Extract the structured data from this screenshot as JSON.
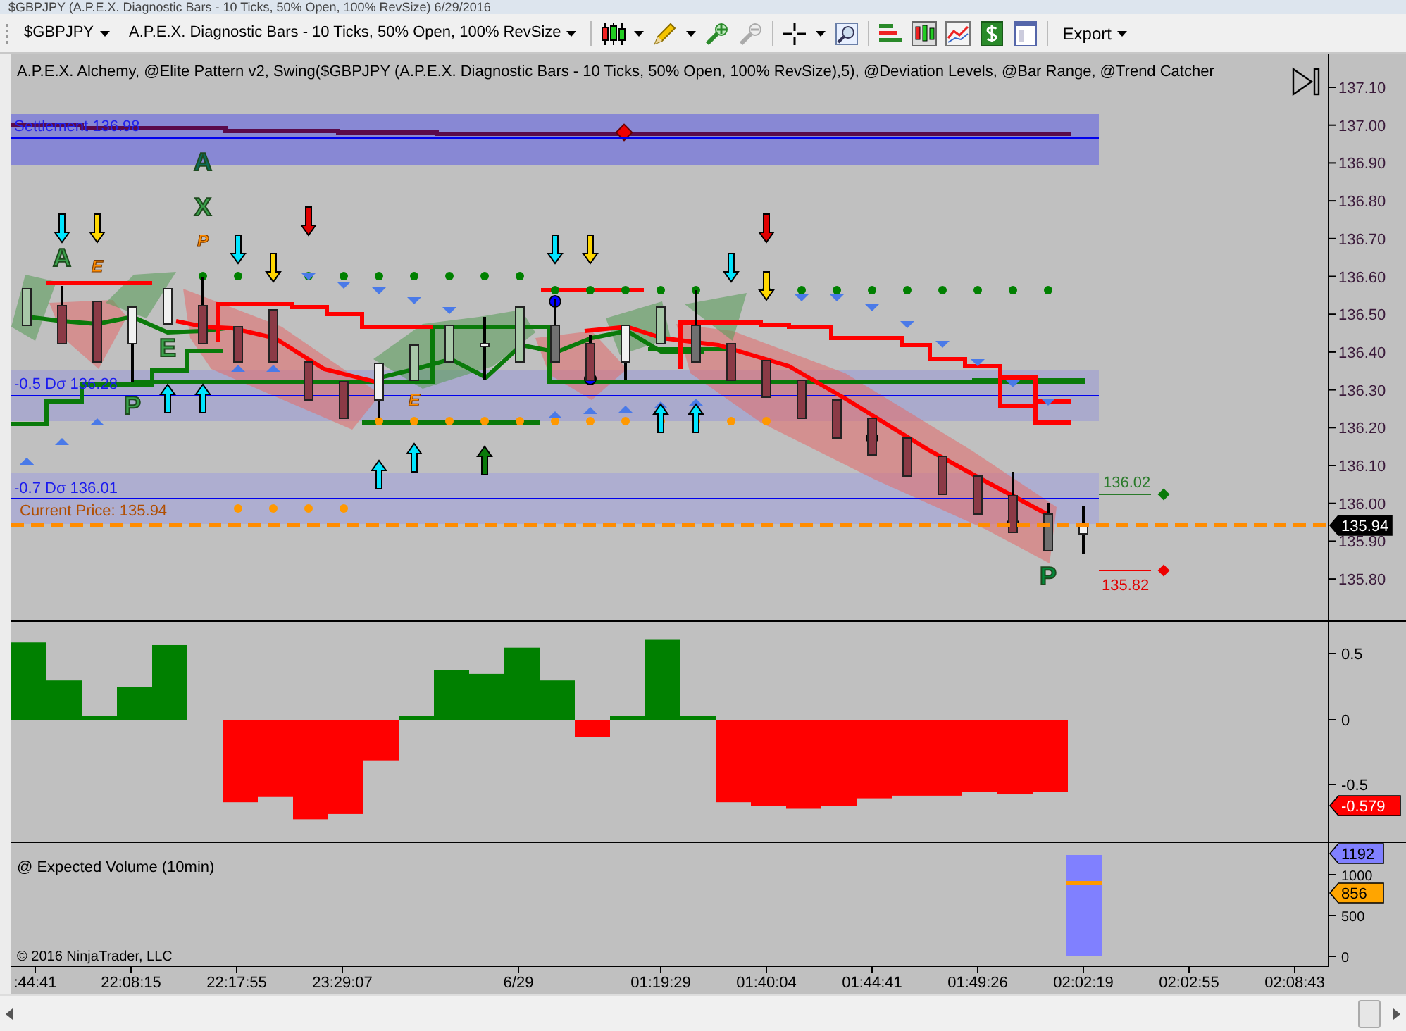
{
  "window": {
    "title": "$GBPJPY (A.P.E.X. Diagnostic Bars - 10 Ticks, 50% Open, 100% RevSize) 6/29/2016"
  },
  "toolbar": {
    "instrument": "$GBPJPY",
    "bar_type": "A.P.E.X. Diagnostic Bars - 10 Ticks, 50% Open, 100% RevSize",
    "export_label": "Export"
  },
  "price_panel": {
    "indicators_label": "A.P.E.X. Alchemy, @Elite Pattern v2, Swing($GBPJPY (A.P.E.X. Diagnostic Bars - 10 Ticks, 50% Open, 100% RevSize),5), @Deviation Levels, @Bar Range, @Trend Catcher",
    "settlement_label": "Settlement 136.98",
    "deviation_labels": [
      "-0.5 Dσ 136.28",
      "-0.7 Dσ 136.01"
    ],
    "current_price_label": "Current Price: 135.94",
    "pattern_letters": [
      {
        "text": "A",
        "kind": "marker",
        "color": "#0b6b55"
      },
      {
        "text": "X",
        "kind": "marker",
        "color": "#3aa04a"
      },
      {
        "text": "P",
        "kind": "note",
        "color": "#ff8c00"
      },
      {
        "text": "A",
        "kind": "marker",
        "color": "#3aa04a"
      },
      {
        "text": "E",
        "kind": "note",
        "color": "#ff8c00"
      },
      {
        "text": "E",
        "kind": "marker",
        "color": "#3aa04a"
      },
      {
        "text": "P",
        "kind": "marker",
        "color": "#3aa04a"
      },
      {
        "text": "E",
        "kind": "note",
        "color": "#ff8c00"
      },
      {
        "text": "P",
        "kind": "marker",
        "color": "#008a3a"
      }
    ],
    "range_high_label": "136.02",
    "range_low_label": "135.82",
    "y_axis_labels": [
      "137.10",
      "137.00",
      "136.90",
      "136.80",
      "136.70",
      "136.60",
      "136.50",
      "136.40",
      "136.30",
      "136.20",
      "136.10",
      "136.00",
      "135.90",
      "135.80"
    ],
    "last_price_marker": "135.94"
  },
  "oscillator_panel": {
    "y_axis_labels": [
      "0.5",
      "0",
      "-0.5"
    ],
    "value_marker": "-0.579"
  },
  "volume_panel": {
    "title": "@ Expected Volume (10min)",
    "y_axis_labels": [
      "1000",
      "500",
      "0"
    ],
    "markers": [
      "1192",
      "856"
    ],
    "copyright": "© 2016 NinjaTrader, LLC"
  },
  "time_axis": [
    ":44:41",
    "22:08:15",
    "22:17:55",
    "23:29:07",
    "6/29",
    "01:19:29",
    "01:40:04",
    "01:44:41",
    "01:49:26",
    "02:02:19",
    "02:02:55",
    "02:08:43"
  ]
}
